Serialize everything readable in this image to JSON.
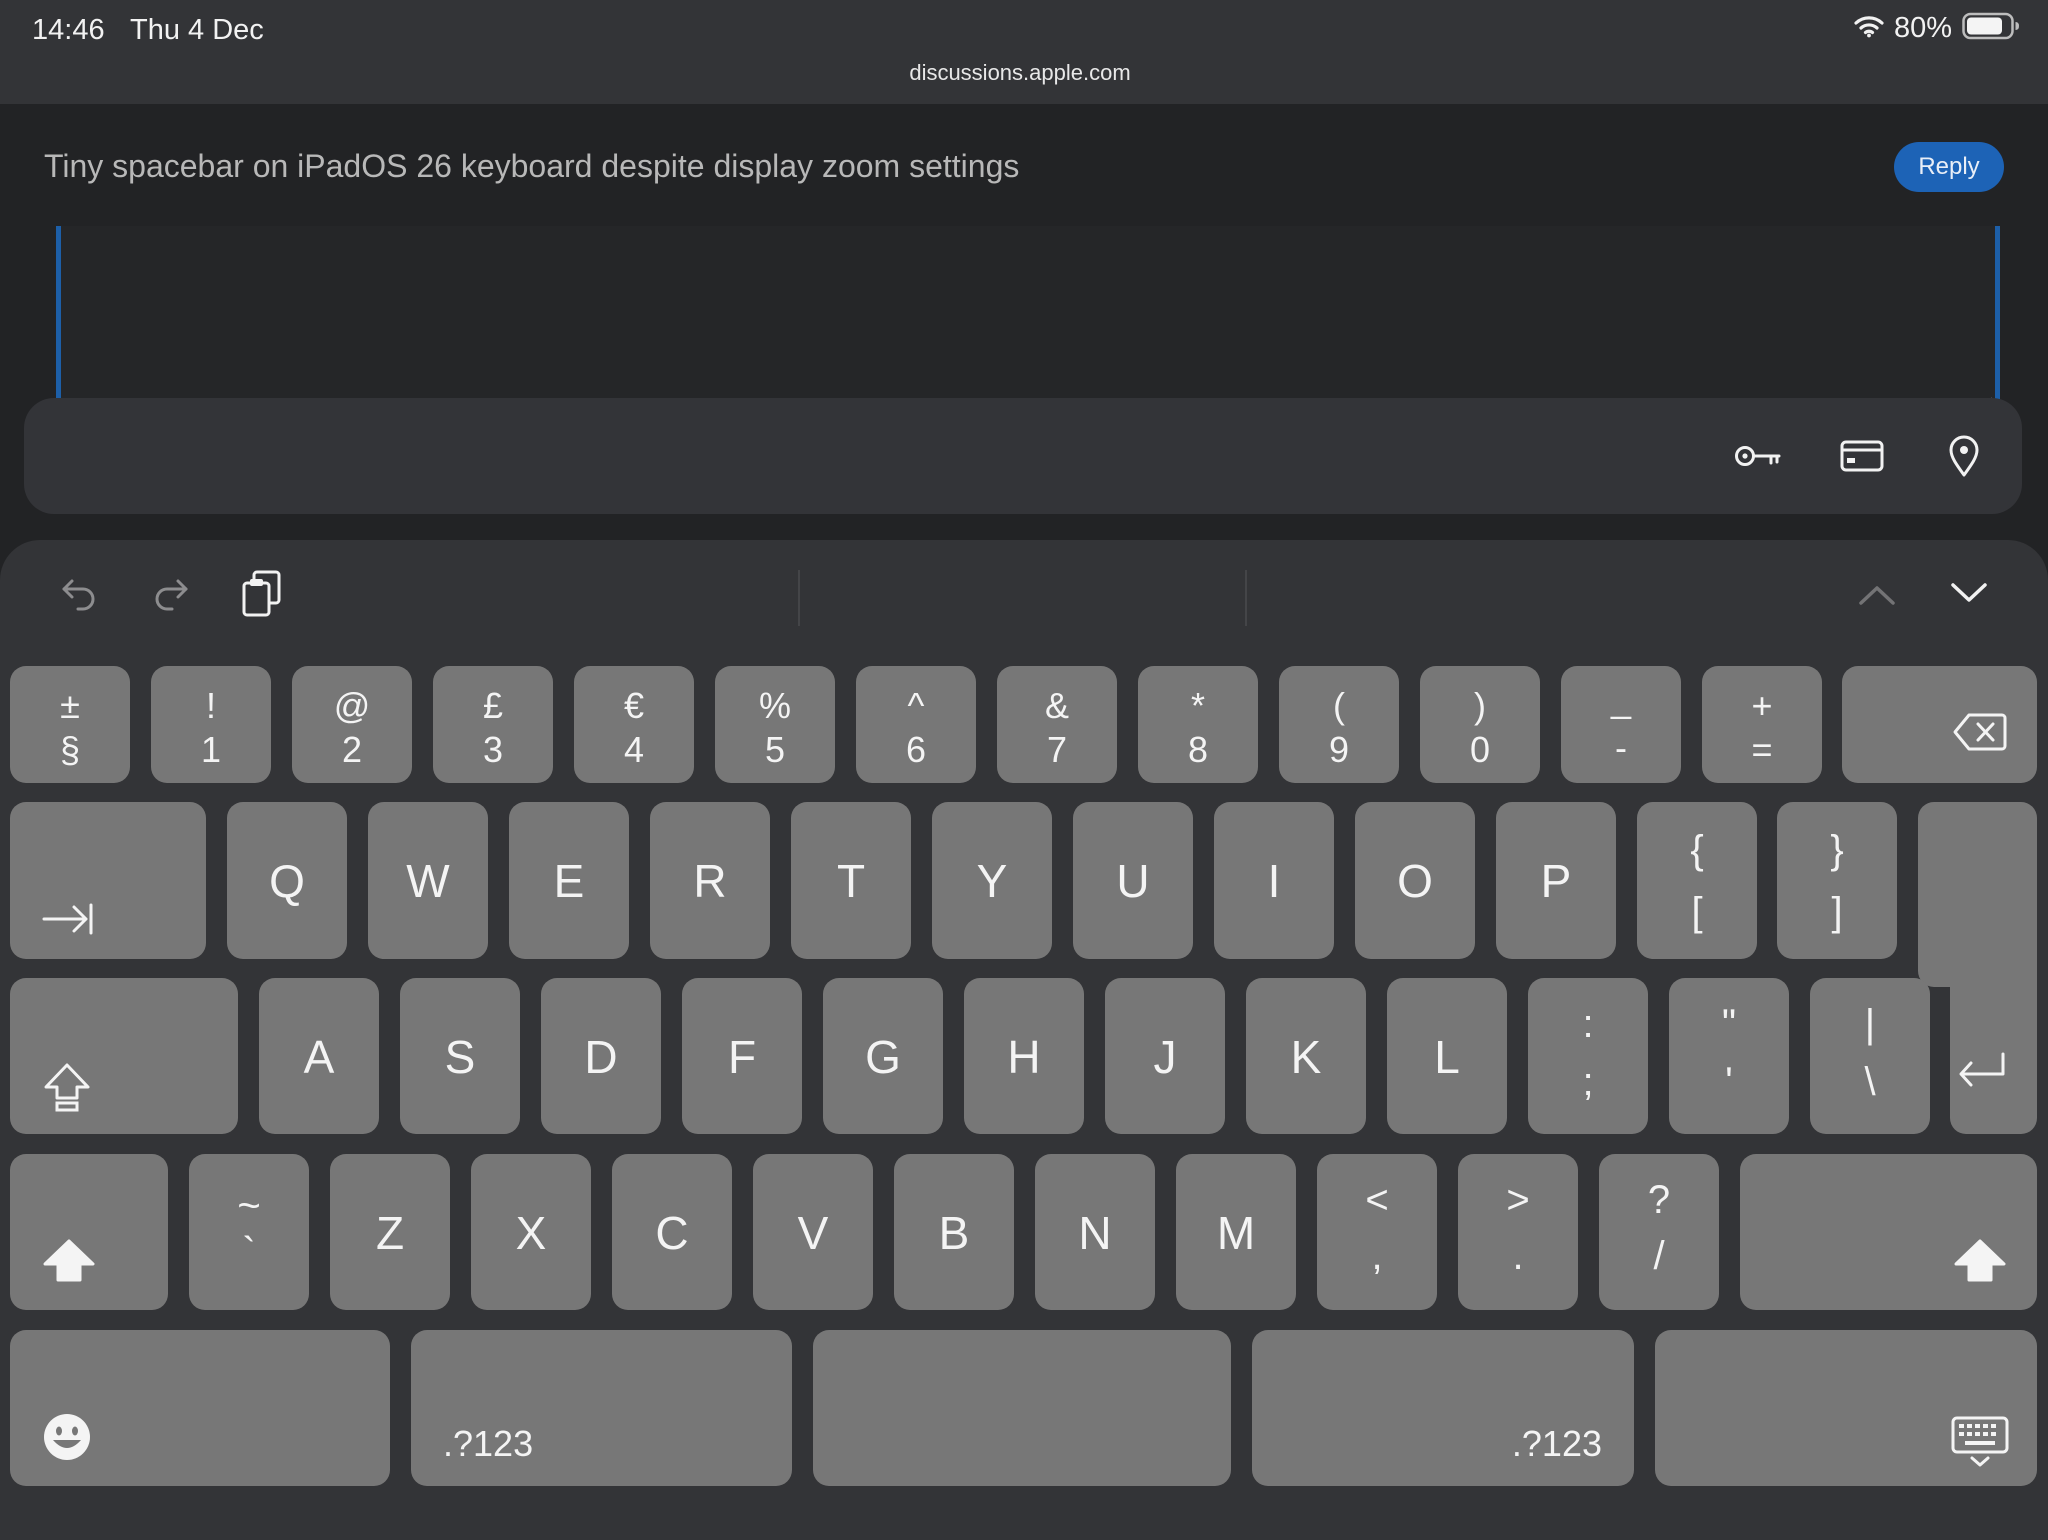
{
  "status_bar": {
    "time": "14:46",
    "date": "Thu 4 Dec",
    "battery": "80%",
    "url": "discussions.apple.com"
  },
  "page": {
    "thread_title": "Tiny spacebar on iPadOS 26 keyboard despite display zoom settings",
    "reply_label": "Reply"
  },
  "autofill": {
    "icons": [
      "key-icon",
      "credit-card-icon",
      "location-pin-icon"
    ]
  },
  "keyboard": {
    "toolbar_icons": [
      "undo-icon",
      "redo-icon",
      "paste-icon",
      "chevron-up-icon",
      "chevron-down-icon"
    ],
    "number_row": [
      {
        "upper": "±",
        "lower": "§"
      },
      {
        "upper": "!",
        "lower": "1"
      },
      {
        "upper": "@",
        "lower": "2"
      },
      {
        "upper": "£",
        "lower": "3"
      },
      {
        "upper": "€",
        "lower": "4"
      },
      {
        "upper": "%",
        "lower": "5"
      },
      {
        "upper": "^",
        "lower": "6"
      },
      {
        "upper": "&",
        "lower": "7"
      },
      {
        "upper": "*",
        "lower": "8"
      },
      {
        "upper": "(",
        "lower": "9"
      },
      {
        "upper": ")",
        "lower": "0"
      },
      {
        "upper": "_",
        "lower": "-"
      },
      {
        "upper": "+",
        "lower": "="
      }
    ],
    "q_row": [
      "Q",
      "W",
      "E",
      "R",
      "T",
      "Y",
      "U",
      "I",
      "O",
      "P"
    ],
    "q_row_symbols": [
      {
        "upper": "{",
        "lower": "["
      },
      {
        "upper": "}",
        "lower": "]"
      }
    ],
    "a_row": [
      "A",
      "S",
      "D",
      "F",
      "G",
      "H",
      "J",
      "K",
      "L"
    ],
    "a_row_symbols": [
      {
        "upper": ":",
        "lower": ";"
      },
      {
        "upper": "\"",
        "lower": "'"
      },
      {
        "upper": "|",
        "lower": "\\"
      }
    ],
    "z_row_first": {
      "upper": "~",
      "lower": "`"
    },
    "z_row": [
      "Z",
      "X",
      "C",
      "V",
      "B",
      "N",
      "M"
    ],
    "z_row_symbols": [
      {
        "upper": "<",
        "lower": ","
      },
      {
        "upper": ">",
        "lower": "."
      },
      {
        "upper": "?",
        "lower": "/"
      }
    ],
    "bottom": {
      "numbers_left": ".?123",
      "numbers_right": ".?123"
    }
  }
}
